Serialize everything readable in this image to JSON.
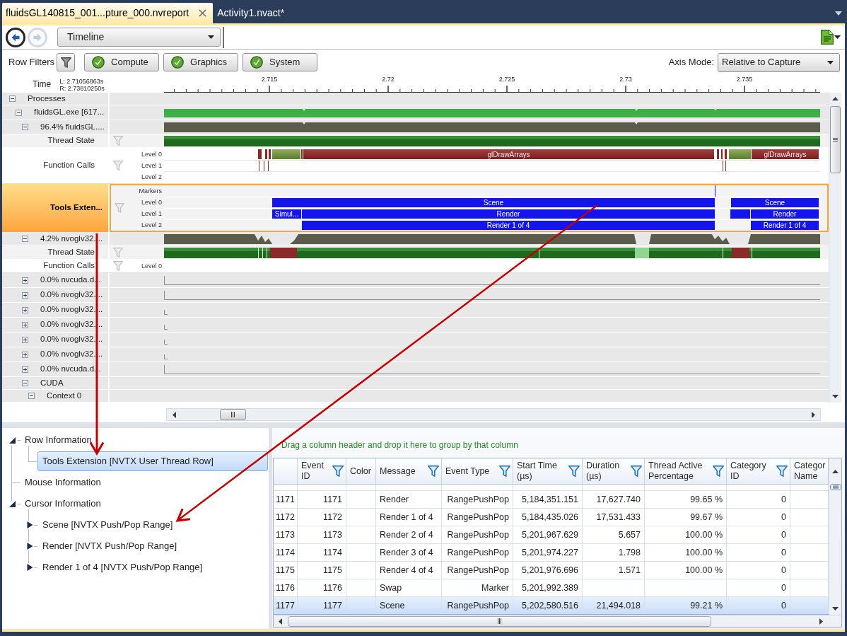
{
  "tabs": [
    {
      "label": "fluidsGL140815_001...pture_000.nvreport",
      "selected": true
    },
    {
      "label": "Activity1.nvact*",
      "selected": false
    }
  ],
  "toolbar": {
    "back": {
      "disabled": false
    },
    "forward": {
      "disabled": true
    },
    "view": "Timeline"
  },
  "row_filters": {
    "label": "Row Filters",
    "filters": [
      {
        "label": "Compute",
        "checked": true
      },
      {
        "label": "Graphics",
        "checked": true
      },
      {
        "label": "System",
        "checked": true
      }
    ]
  },
  "axis_mode": {
    "label": "Axis Mode:",
    "value": "Relative to Capture"
  },
  "time_ruler": {
    "label": "Time",
    "range_start": "L: 2.71056863s",
    "range_end": "R: 2.73810250s",
    "ticks": [
      "2.715",
      "2.72",
      "2.725",
      "2.73",
      "2.735"
    ]
  },
  "timeline_rows": [
    {
      "label": "Processes",
      "kind": "group",
      "expanded": true,
      "selected": false,
      "children": [
        {
          "label": "fluidsGL.exe [617...",
          "kind": "process",
          "expanded": true,
          "selected": false,
          "children": [
            {
              "label": "96.4% fluidsGL....",
              "kind": "thread",
              "expanded": true,
              "selected": false,
              "children": [
                {
                  "label": "Thread State",
                  "kind": "thread_state",
                  "selected": false
                },
                {
                  "label": "Function Calls",
                  "kind": "function_calls",
                  "selected": false,
                  "lanes": [
                    {
                      "label": "Level 0",
                      "bars": [
                        {
                          "label": "glDrawArrays"
                        },
                        {
                          "label": "glDrawArrays"
                        }
                      ]
                    },
                    {
                      "label": "Level 1"
                    },
                    {
                      "label": "Level 2"
                    }
                  ]
                },
                {
                  "label": "Tools Exten...",
                  "kind": "nvtx",
                  "selected": true,
                  "lanes": [
                    {
                      "label": "Markers"
                    },
                    {
                      "label": "Level 0",
                      "bars": [
                        {
                          "label": "Scene"
                        },
                        {
                          "label": "Scene"
                        }
                      ]
                    },
                    {
                      "label": "Level 1",
                      "bars": [
                        {
                          "label": "Simul..."
                        },
                        {
                          "label": "Render"
                        },
                        {
                          "label": "Render"
                        }
                      ]
                    },
                    {
                      "label": "Level 2",
                      "bars": [
                        {
                          "label": "Render 1 of 4"
                        },
                        {
                          "label": "Render 1 of 4"
                        }
                      ]
                    }
                  ]
                }
              ]
            },
            {
              "label": "4.2% nvoglv32....",
              "kind": "thread",
              "expanded": true,
              "selected": false,
              "children": [
                {
                  "label": "Thread State",
                  "kind": "thread_state",
                  "selected": false
                },
                {
                  "label": "Function Calls",
                  "kind": "function_calls",
                  "selected": false,
                  "lanes": [
                    {
                      "label": "Level 0"
                    }
                  ]
                }
              ]
            },
            {
              "label": "0.0% nvcuda.d...",
              "kind": "thread",
              "expanded": false,
              "selected": false
            },
            {
              "label": "0.0% nvoglv32....",
              "kind": "thread",
              "expanded": false,
              "selected": false
            },
            {
              "label": "0.0% nvoglv32....",
              "kind": "thread",
              "expanded": false,
              "selected": false
            },
            {
              "label": "0.0% nvoglv32....",
              "kind": "thread",
              "expanded": false,
              "selected": false
            },
            {
              "label": "0.0% nvoglv32....",
              "kind": "thread",
              "expanded": false,
              "selected": false
            },
            {
              "label": "0.0% nvoglv32....",
              "kind": "thread",
              "expanded": false,
              "selected": false
            },
            {
              "label": "0.0% nvcuda.d...",
              "kind": "thread",
              "expanded": false,
              "selected": false
            },
            {
              "label": "CUDA",
              "kind": "group",
              "expanded": true,
              "selected": false,
              "children": [
                {
                  "label": "Context 0",
                  "kind": "group",
                  "expanded": true,
                  "selected": false
                }
              ]
            }
          ]
        }
      ]
    }
  ],
  "info_tree": [
    {
      "label": "Row Information",
      "expanded": true,
      "selected": false,
      "children": [
        {
          "label": "Tools Extension [NVTX User Thread Row]",
          "selected": true
        }
      ]
    },
    {
      "label": "Mouse Information",
      "selected": false
    },
    {
      "label": "Cursor Information",
      "expanded": true,
      "selected": false,
      "children": [
        {
          "label": "Scene [NVTX Push/Pop Range]",
          "expanded": false,
          "selected": false
        },
        {
          "label": "Render [NVTX Push/Pop Range]",
          "expanded": false,
          "selected": false
        },
        {
          "label": "Render 1 of 4 [NVTX Push/Pop Range]",
          "expanded": false,
          "selected": false
        }
      ]
    }
  ],
  "events_table": {
    "group_hint": "Drag a column header and drop it here to group by that column",
    "columns": [
      {
        "label": "Event ID",
        "filter": true
      },
      {
        "label": "Color",
        "filter": false
      },
      {
        "label": "Message",
        "filter": true
      },
      {
        "label": "Event Type",
        "filter": true
      },
      {
        "label": "Start Time (µs)",
        "filter": true
      },
      {
        "label": "Duration (µs)",
        "filter": true
      },
      {
        "label": "Thread Active Percentage",
        "filter": true
      },
      {
        "label": "Category ID",
        "filter": true
      },
      {
        "label": "Categor Name",
        "filter": false
      }
    ],
    "rows": [
      {
        "number": "1171",
        "selected": false,
        "cells": [
          "1171",
          null,
          "Render",
          "RangePushPop",
          "5,184,351.151",
          "17,627.740",
          "99.65 %",
          "0"
        ]
      },
      {
        "number": "1172",
        "selected": false,
        "cells": [
          "1172",
          null,
          "Render 1 of 4",
          "RangePushPop",
          "5,184,435.026",
          "17,531.433",
          "99.67 %",
          "0"
        ]
      },
      {
        "number": "1173",
        "selected": false,
        "cells": [
          "1173",
          null,
          "Render 2 of 4",
          "RangePushPop",
          "5,201,967.629",
          "5.657",
          "100.00 %",
          "0"
        ]
      },
      {
        "number": "1174",
        "selected": false,
        "cells": [
          "1174",
          null,
          "Render 3 of 4",
          "RangePushPop",
          "5,201,974.227",
          "1.798",
          "100.00 %",
          "0"
        ]
      },
      {
        "number": "1175",
        "selected": false,
        "cells": [
          "1175",
          null,
          "Render 4 of 4",
          "RangePushPop",
          "5,201,976.696",
          "1.571",
          "100.00 %",
          "0"
        ]
      },
      {
        "number": "1176",
        "selected": false,
        "cells": [
          "1176",
          null,
          "Swap",
          "Marker",
          "5,201,992.389",
          null,
          null,
          "0"
        ]
      },
      {
        "number": "1177",
        "selected": true,
        "cells": [
          "1177",
          null,
          "Scene",
          "RangePushPop",
          "5,202,580.516",
          "21,494.018",
          "99.21 %",
          "0"
        ]
      }
    ]
  }
}
